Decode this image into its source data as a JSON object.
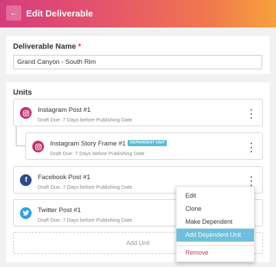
{
  "header": {
    "back_glyph": "←",
    "title": "Edit Deliverable"
  },
  "name_section": {
    "label": "Deliverable Name",
    "required_mark": "*",
    "value": "Grand Canyon - South Rim"
  },
  "units_section": {
    "label": "Units",
    "units": [
      {
        "title": "Instagram Post #1",
        "subtitle": "Draft Due: 7 Days before Publishing Date",
        "icon": "instagram-icon"
      },
      {
        "title": "Instagram Story Frame #1",
        "badge": "DEPENDENT UNIT",
        "subtitle": "Draft Due: 7 Days before Publishing Date",
        "icon": "instagram-icon"
      },
      {
        "title": "Facebook Post #1",
        "subtitle": "Draft Due: 7 Days before Publishing Date",
        "icon": "facebook-icon"
      },
      {
        "title": "Twitter Post #1",
        "subtitle": "Draft Due: 7 Days before Publishing Date",
        "icon": "twitter-icon"
      }
    ],
    "add_unit_label": "Add Unit"
  },
  "context_menu": {
    "items": [
      "Edit",
      "Clone",
      "Make Dependent",
      "Add Dependent Unit",
      "Remove"
    ],
    "highlighted": "Add Dependent Unit"
  },
  "colors": {
    "header_gradient": [
      "#d53c7c",
      "#f6a13d"
    ],
    "instagram": "#c42f6e",
    "facebook": "#2d4a8a",
    "twitter": "#2da1e6",
    "badge": "#5cb9dd",
    "menu_highlight": "#6fc0de",
    "remove": "#c0395a"
  }
}
